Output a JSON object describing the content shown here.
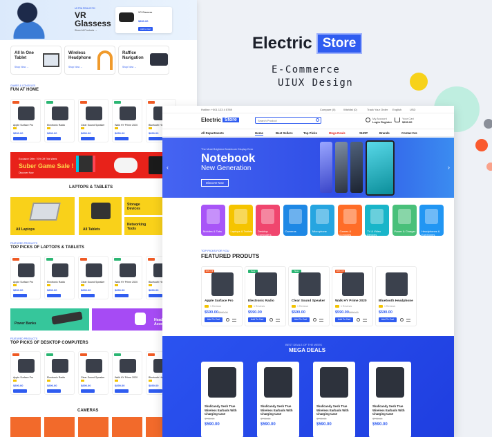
{
  "brand": {
    "word": "Electric",
    "store": "Store",
    "subtitle_line1": "E-Commerce",
    "subtitle_line2": "UIUX Design",
    "accent": "#2f5cf0"
  },
  "left": {
    "hero": {
      "kicker": "ULTRA REALISTIC",
      "title": "VR Glassess",
      "link": "Show All Products →",
      "product_name": "VR Glassess",
      "price": "$890.00",
      "btn": "Add to Cart"
    },
    "feature_cards": [
      {
        "title": "All In One Tablet",
        "link": "Shop Now →"
      },
      {
        "title": "Wireless Headphone",
        "link": "Shop Now →"
      },
      {
        "title": "Raffice Navigation",
        "link": "Shop Now →"
      }
    ],
    "fun_kicker": "GAMES & CONSOLES",
    "fun_title": "FUN AT HOME",
    "fun_products": [
      {
        "name": "Apple Surface Pro",
        "price": "$890.00"
      },
      {
        "name": "Electronic Radio",
        "price": "$890.00"
      },
      {
        "name": "Clear Sound Speaker",
        "price": "$890.00"
      },
      {
        "name": "Walk HY Prime 2020",
        "price": "$890.00"
      },
      {
        "name": "Bluetooth Headphone",
        "price": "$890.00"
      }
    ],
    "game_banner": {
      "kicker": "Exclusive Offer: 70% Off This Week",
      "title": "Suber Game Sale !",
      "link": "Discover Now"
    },
    "laptops_heading": "LAPTOPS & TABLETS",
    "laptop_tiles": [
      "All Laptops",
      "All Tablets",
      "Storage Devices",
      "Networking Tools"
    ],
    "top_laptops_kicker": "FEATURED PRODUCTS",
    "top_laptops_title": "TOP PICKS OF LAPTOPS & TABLETS",
    "laptop_products": [
      {
        "name": "Apple Surface Pro",
        "price": "$890.00"
      },
      {
        "name": "Electronic Radio",
        "price": "$890.00"
      },
      {
        "name": "Clear Sound Speaker",
        "price": "$890.00"
      },
      {
        "name": "Walk HY Prime 2020",
        "price": "$890.00"
      },
      {
        "name": "Bluetooth Headphone",
        "price": "$890.00"
      }
    ],
    "power_banks": "Power Banks",
    "headsets": "Headsets & Adults Accessories",
    "desktop_kicker": "FEATURED PRODUCTS",
    "desktop_title": "TOP PICKS OF DESKTOP COMPUTERS",
    "desktop_products": [
      {
        "name": "Apple Surface Pro",
        "price": "$890.00"
      },
      {
        "name": "Electronic Radio",
        "price": "$890.00"
      },
      {
        "name": "Clear Sound Speaker",
        "price": "$890.00"
      },
      {
        "name": "Walk HY Prime 2020",
        "price": "$890.00"
      },
      {
        "name": "Bluetooth Headphone",
        "price": "$890.00"
      }
    ],
    "cameras_heading": "CAMERAS"
  },
  "right": {
    "topbar": {
      "hotline": "Hotline: +001 123 4 5789",
      "compare": "Compare (0)",
      "wishlist": "Wishlist (0)",
      "track": "Track Your Order",
      "lang": "English",
      "currency": "USD"
    },
    "logo_word": "Electric",
    "logo_store": "Store",
    "search_placeholder": "Search Product",
    "account": {
      "line1": "My Account",
      "line2": "Login Register"
    },
    "cart": {
      "line1": "Your Cart",
      "line2": "$200.00"
    },
    "nav": [
      "All Departments",
      "Home",
      "Best Sellers",
      "Top Picks",
      "Mega Deals",
      "SHOP",
      "Brands",
      "Contact Us"
    ],
    "slider": {
      "kicker": "The Most Brightest Notebook Display Ever",
      "title1": "Notebook",
      "title2": "New Generation",
      "btn": "Discover Now"
    },
    "categories": [
      {
        "label": "Mobiles & Tabs",
        "color": "#a855f7"
      },
      {
        "label": "Laptops & Tablets",
        "color": "#f5c400"
      },
      {
        "label": "Desktop Computers",
        "color": "#f0466e"
      },
      {
        "label": "Cameras",
        "color": "#1e88e5"
      },
      {
        "label": "Microphone",
        "color": "#26a5e0"
      },
      {
        "label": "Games & Consoles",
        "color": "#ff6d28"
      },
      {
        "label": "TV & Video Devices",
        "color": "#19b5c9"
      },
      {
        "label": "Power & Charger",
        "color": "#49c07a"
      },
      {
        "label": "Headphones & Earphones",
        "color": "#2196f3"
      }
    ],
    "featured_kicker": "TOP PICKS FOR YOU",
    "featured_title": "FEATURED PRODUTS",
    "featured": [
      {
        "name": "Apple Surface Pro",
        "price": "$590.00",
        "old": "$690.00",
        "badge": "30% Off",
        "badge_color": "#ef5a24"
      },
      {
        "name": "Electronic Radio",
        "price": "$590.00",
        "old": "",
        "badge": "New",
        "badge_color": "#2bb673"
      },
      {
        "name": "Clear Sound Speaker",
        "price": "$590.00",
        "old": "",
        "badge": "New",
        "badge_color": "#2bb673"
      },
      {
        "name": "Walk HY Prime 2020",
        "price": "$590.00",
        "old": "$690.00",
        "badge": "30% Off",
        "badge_color": "#ef5a24"
      },
      {
        "name": "Bluetooth Headphone",
        "price": "$590.00",
        "old": "",
        "badge": "",
        "badge_color": ""
      }
    ],
    "add_to_cart": "Add To Cart",
    "reviews": "1 Reviews",
    "mega_kicker": "BEST DEALS OF THE WEEK",
    "mega_title": "MEGA DEALS",
    "mega": [
      {
        "name": "Skullcandy Sesh True Wireless Earbuds With Charging Case",
        "old": "$790.00",
        "price": "$590.00"
      },
      {
        "name": "Skullcandy Sesh True Wireless Earbuds With Charging Case",
        "old": "$790.00",
        "price": "$590.00"
      },
      {
        "name": "Skullcandy Sesh True Wireless Earbuds With Charging Case",
        "old": "$790.00",
        "price": "$590.00"
      },
      {
        "name": "Skullcandy Sesh True Wireless Earbuds With Charging Case",
        "old": "$790.00",
        "price": "$590.00"
      }
    ]
  }
}
